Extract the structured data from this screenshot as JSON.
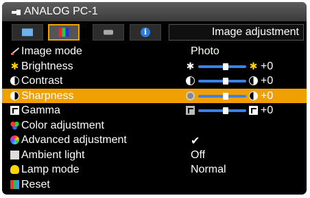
{
  "topbar": {
    "source": "ANALOG PC-1"
  },
  "tabs": [
    {
      "icon": "screen-icon",
      "active": false
    },
    {
      "icon": "rgb-adjust-icon",
      "active": true
    },
    {
      "icon": "projector-icon",
      "active": false
    },
    {
      "icon": "info-icon",
      "active": false,
      "glyph": "i"
    }
  ],
  "heading": "Image adjustment",
  "menu": [
    {
      "label": "Image mode",
      "icon": "image-mode-icon",
      "value": "Photo"
    },
    {
      "label": "Brightness",
      "icon": "brightness-icon",
      "slider_value": "+0",
      "level": 0.5
    },
    {
      "label": "Contrast",
      "icon": "contrast-icon",
      "slider_value": "+0",
      "level": 0.5
    },
    {
      "label": "Sharpness",
      "icon": "sharpness-icon",
      "slider_value": "+0",
      "level": 0.5,
      "selected": true
    },
    {
      "label": "Gamma",
      "icon": "gamma-icon",
      "slider_value": "+0",
      "level": 0.5
    },
    {
      "label": "Color adjustment",
      "icon": "color-adjust-icon"
    },
    {
      "label": "Advanced adjustment",
      "icon": "advanced-adjust-icon",
      "value": "✔"
    },
    {
      "label": "Ambient light",
      "icon": "ambient-light-icon",
      "value": "Off"
    },
    {
      "label": "Lamp mode",
      "icon": "lamp-icon",
      "value": "Normal"
    },
    {
      "label": "Reset",
      "icon": "reset-icon"
    }
  ],
  "colors": {
    "accent": "#f0a000",
    "slider": "#3a82e8",
    "background": "#000000"
  }
}
